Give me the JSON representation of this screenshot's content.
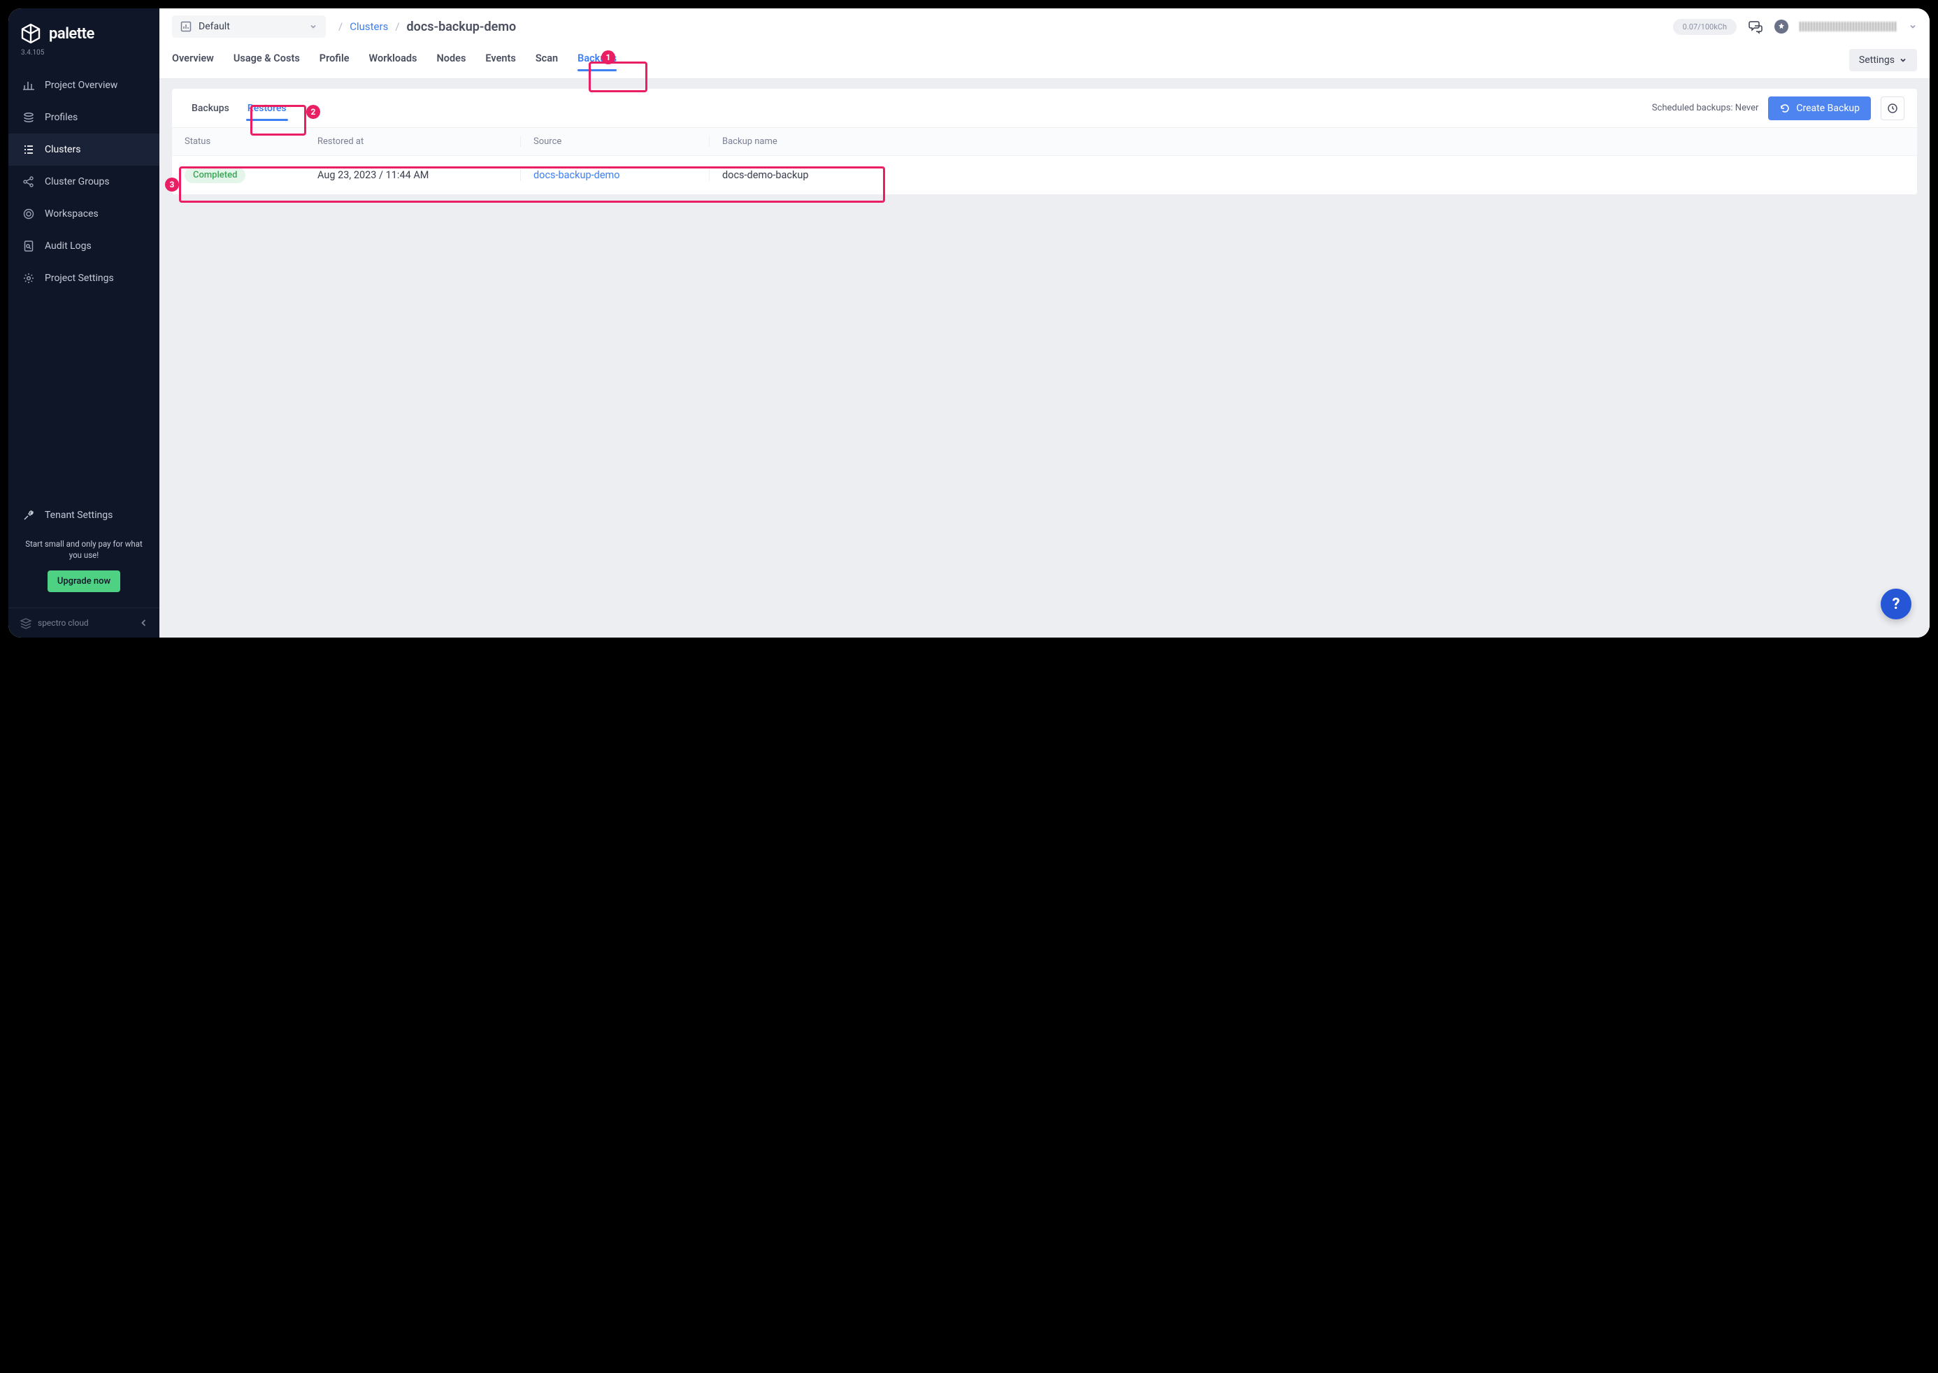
{
  "brand": {
    "name": "palette",
    "version": "3.4.105",
    "footer": "spectro cloud"
  },
  "sidebar": {
    "items": [
      {
        "label": "Project Overview"
      },
      {
        "label": "Profiles"
      },
      {
        "label": "Clusters"
      },
      {
        "label": "Cluster Groups"
      },
      {
        "label": "Workspaces"
      },
      {
        "label": "Audit Logs"
      },
      {
        "label": "Project Settings"
      }
    ],
    "tenant_label": "Tenant Settings",
    "promo_line": "Start small and only pay for what you use!",
    "upgrade_label": "Upgrade now"
  },
  "topbar": {
    "project_selected": "Default",
    "breadcrumb_parent": "Clusters",
    "breadcrumb_current": "docs-backup-demo",
    "usage_text": "0.07/100kCh"
  },
  "cluster_tabs": [
    "Overview",
    "Usage & Costs",
    "Profile",
    "Workloads",
    "Nodes",
    "Events",
    "Scan",
    "Backups"
  ],
  "cluster_tabs_active": "Backups",
  "settings_label": "Settings",
  "subtabs": [
    "Backups",
    "Restores"
  ],
  "subtabs_active": "Restores",
  "scheduled_text": "Scheduled backups: Never",
  "create_backup_label": "Create Backup",
  "table": {
    "headers": {
      "status": "Status",
      "restored": "Restored at",
      "source": "Source",
      "backup": "Backup name"
    },
    "rows": [
      {
        "status": "Completed",
        "restored": "Aug 23, 2023 / 11:44 AM",
        "source": "docs-backup-demo",
        "backup": "docs-demo-backup"
      }
    ]
  },
  "callouts": {
    "c1": "1",
    "c2": "2",
    "c3": "3"
  },
  "help_fab": "?"
}
